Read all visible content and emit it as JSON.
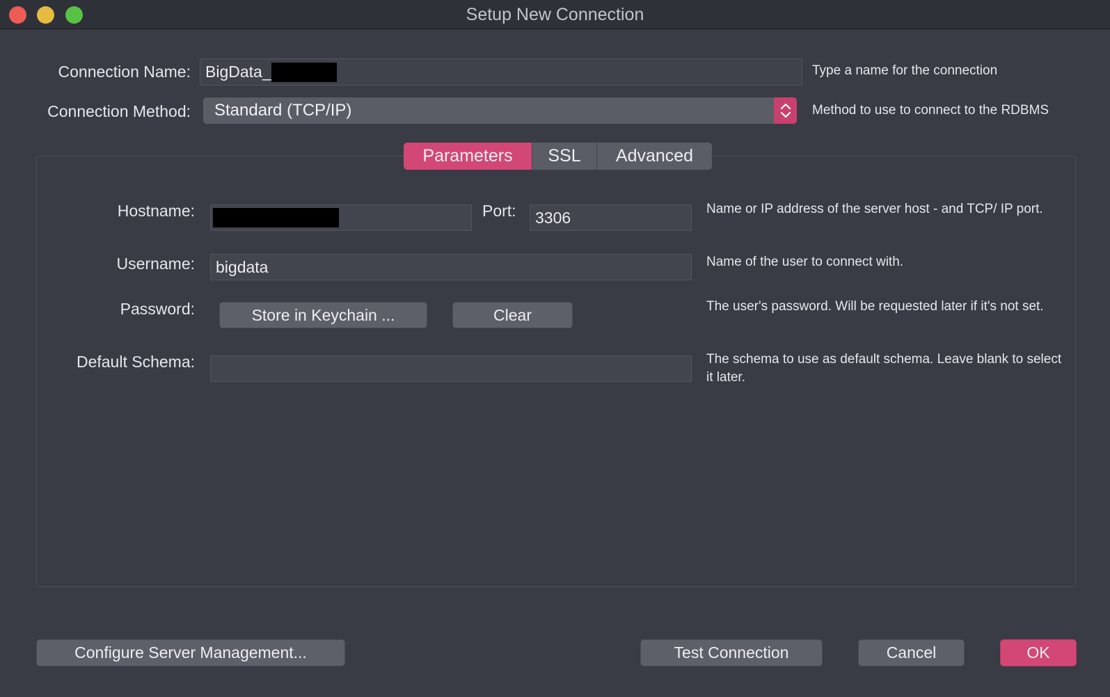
{
  "window": {
    "title": "Setup New Connection"
  },
  "connection_name": {
    "label": "Connection Name:",
    "value": "BigData_",
    "hint": "Type a name for the connection"
  },
  "connection_method": {
    "label": "Connection Method:",
    "value": "Standard (TCP/IP)",
    "hint": "Method to use to connect to the RDBMS"
  },
  "tabs": [
    {
      "label": "Parameters",
      "active": true
    },
    {
      "label": "SSL",
      "active": false
    },
    {
      "label": "Advanced",
      "active": false
    }
  ],
  "parameters": {
    "hostname": {
      "label": "Hostname:",
      "value": "",
      "hint": "Name or IP address of the server host - and TCP/ IP port."
    },
    "port": {
      "label": "Port:",
      "value": "3306"
    },
    "username": {
      "label": "Username:",
      "value": "bigdata",
      "hint": "Name of the user to connect with."
    },
    "password": {
      "label": "Password:",
      "store_button": "Store in Keychain ...",
      "clear_button": "Clear",
      "hint": "The user's password. Will be requested later if it's not set."
    },
    "default_schema": {
      "label": "Default Schema:",
      "value": "",
      "hint": "The schema to use as default schema. Leave blank to select it later."
    }
  },
  "footer": {
    "configure_button": "Configure Server Management...",
    "test_button": "Test Connection",
    "cancel_button": "Cancel",
    "ok_button": "OK"
  },
  "colors": {
    "accent": "#d24775",
    "background": "#393b45",
    "field": "#42444e"
  },
  "icons": {
    "close": "close-icon",
    "minimize": "minimize-icon",
    "zoom": "zoom-icon",
    "select_arrows": "chevron-up-down-icon"
  }
}
